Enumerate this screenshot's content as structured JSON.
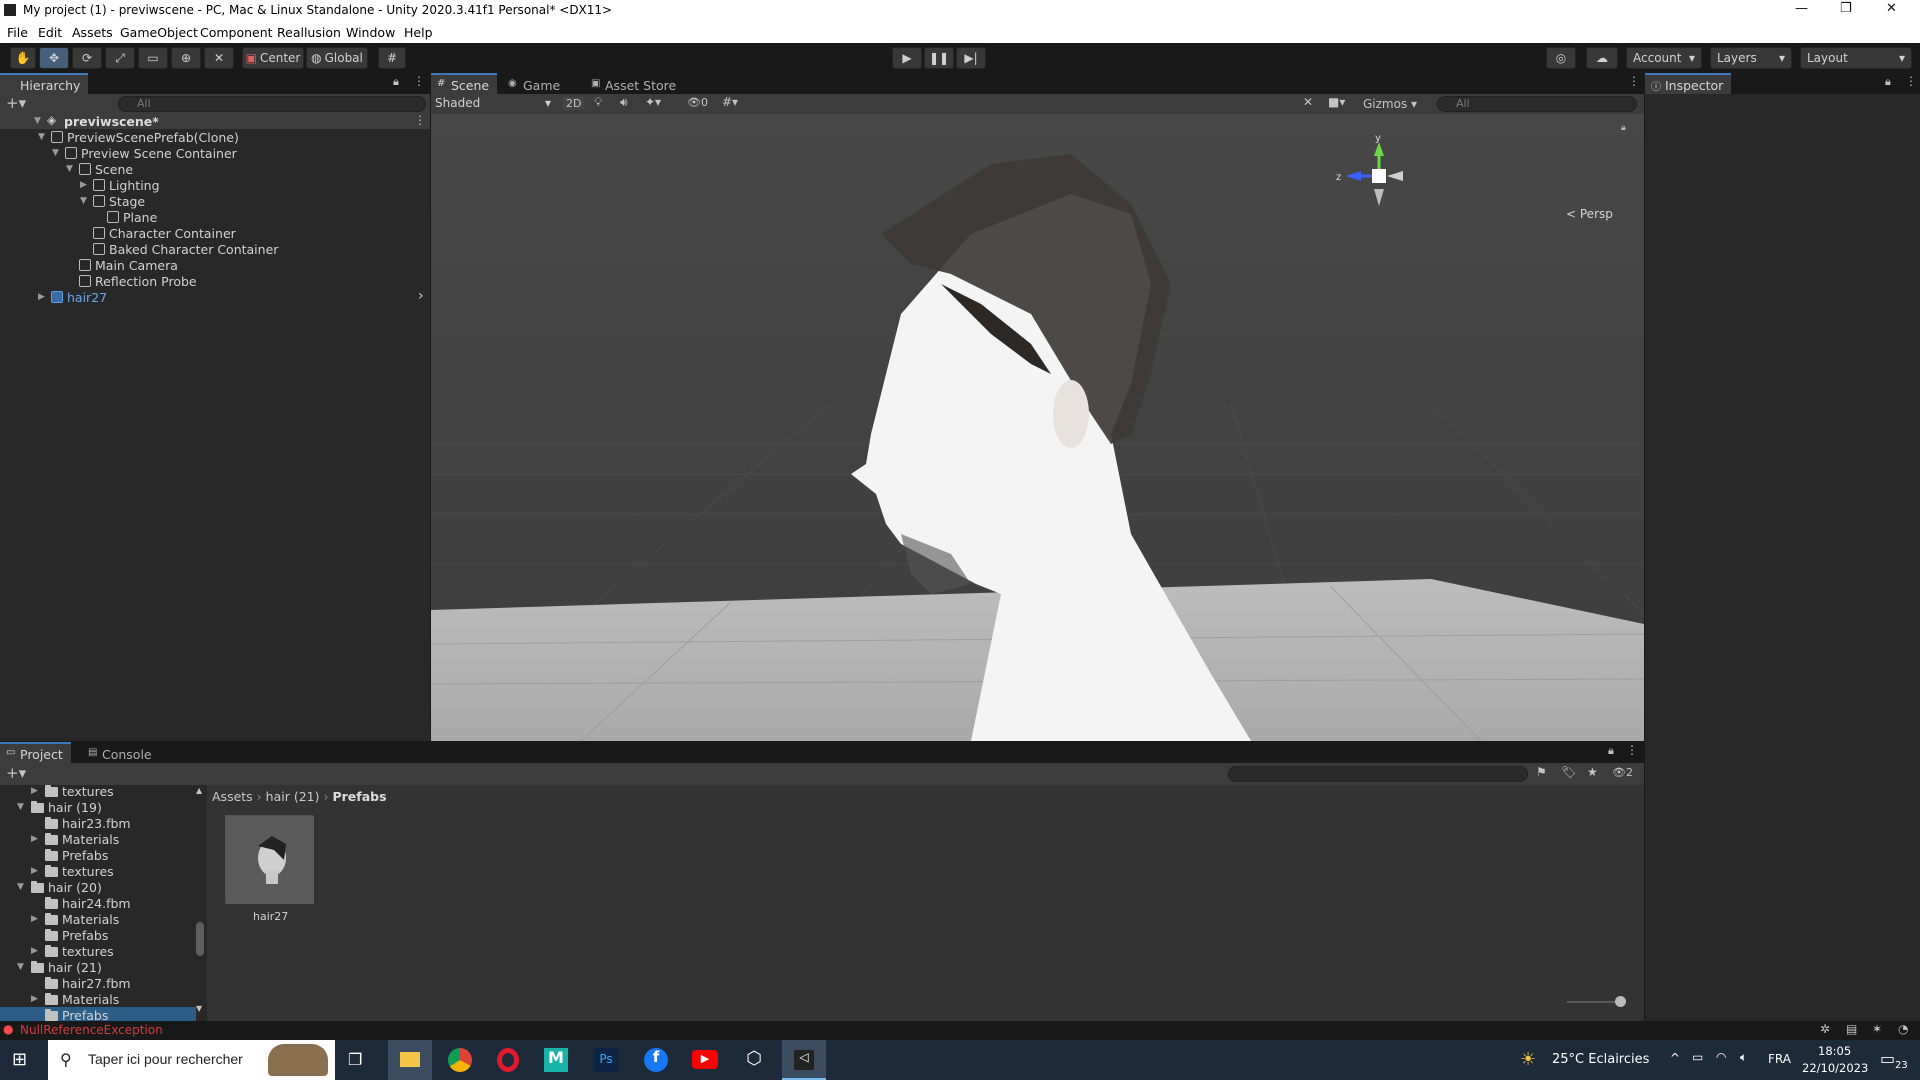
{
  "window": {
    "title": "My project (1) - previwscene - PC, Mac & Linux Standalone - Unity 2020.3.41f1 Personal* <DX11>"
  },
  "menu": [
    "File",
    "Edit",
    "Assets",
    "GameObject",
    "Component",
    "Reallusion",
    "Window",
    "Help"
  ],
  "toolbar": {
    "pivot": "Center",
    "space": "Global",
    "account": "Account",
    "layers": "Layers",
    "layout": "Layout"
  },
  "hierarchy": {
    "tab": "Hierarchy",
    "search_placeholder": "All",
    "scene": "previwscene*",
    "items": [
      {
        "label": "PreviewScenePrefab(Clone)",
        "depth": 1
      },
      {
        "label": "Preview Scene Container",
        "depth": 2
      },
      {
        "label": "Scene",
        "depth": 3
      },
      {
        "label": "Lighting",
        "depth": 4
      },
      {
        "label": "Stage",
        "depth": 4
      },
      {
        "label": "Plane",
        "depth": 5
      },
      {
        "label": "Character Container",
        "depth": 4
      },
      {
        "label": "Baked Character Container",
        "depth": 4
      },
      {
        "label": "Main Camera",
        "depth": 3
      },
      {
        "label": "Reflection Probe",
        "depth": 3
      },
      {
        "label": "hair27",
        "depth": 1
      }
    ]
  },
  "scene_view": {
    "tabs": [
      "Scene",
      "Game",
      "Asset Store"
    ],
    "shading": "Shaded",
    "mode_2d": "2D",
    "hidden_count": "0",
    "gizmos": "Gizmos",
    "search_placeholder": "All",
    "persp": "Persp",
    "axis_y": "y",
    "axis_z": "z"
  },
  "inspector": {
    "tab": "Inspector"
  },
  "project": {
    "tabs": [
      "Project",
      "Console"
    ],
    "tree": [
      {
        "label": "textures",
        "depth": 2
      },
      {
        "label": "hair (19)",
        "depth": 1
      },
      {
        "label": "hair23.fbm",
        "depth": 2
      },
      {
        "label": "Materials",
        "depth": 2
      },
      {
        "label": "Prefabs",
        "depth": 2
      },
      {
        "label": "textures",
        "depth": 2
      },
      {
        "label": "hair (20)",
        "depth": 1
      },
      {
        "label": "hair24.fbm",
        "depth": 2
      },
      {
        "label": "Materials",
        "depth": 2
      },
      {
        "label": "Prefabs",
        "depth": 2
      },
      {
        "label": "textures",
        "depth": 2
      },
      {
        "label": "hair (21)",
        "depth": 1
      },
      {
        "label": "hair27.fbm",
        "depth": 2
      },
      {
        "label": "Materials",
        "depth": 2
      },
      {
        "label": "Prefabs",
        "depth": 2
      }
    ],
    "breadcrumb": [
      "Assets",
      "hair (21)",
      "Prefabs"
    ],
    "asset": "hair27",
    "hidden_count": "2"
  },
  "status": {
    "error": "NullReferenceException"
  },
  "taskbar": {
    "search": "Taper ici pour rechercher",
    "weather": "25°C Eclaircies",
    "lang": "FRA",
    "time": "18:05",
    "date": "22/10/2023",
    "notif": "23"
  }
}
